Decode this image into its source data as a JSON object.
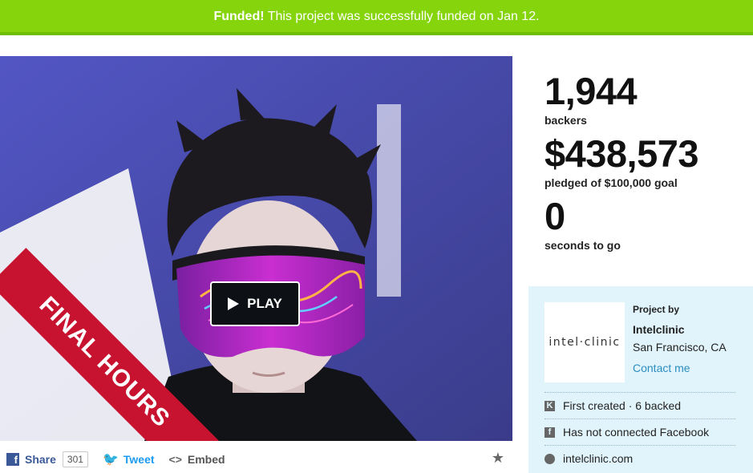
{
  "banner": {
    "funded_label": "Funded!",
    "message": "This project was successfully funded on Jan 12.",
    "color": "#86d40c"
  },
  "video": {
    "play_label": "PLAY",
    "ribbon_text": "FINAL HOURS",
    "ribbon_color": "#c7132f"
  },
  "share_bar": {
    "share_label": "Share",
    "share_count": "301",
    "tweet_label": "Tweet",
    "embed_label": "Embed",
    "embed_icon": "<>"
  },
  "stats": {
    "backers_value": "1,944",
    "backers_label": "backers",
    "pledged_value": "$438,573",
    "pledged_label": "pledged of $100,000 goal",
    "time_value": "0",
    "time_label": "seconds to go"
  },
  "creator": {
    "logo_text": "intel·clinic",
    "project_by": "Project by",
    "name": "Intelclinic",
    "location": "San Francisco, CA",
    "contact": "Contact me",
    "first_created": "First created · 6 backed",
    "facebook": "Has not connected Facebook",
    "website": "intelclinic.com"
  },
  "icons": {
    "facebook": "facebook-icon",
    "twitter": "twitter-icon",
    "embed": "embed-icon",
    "star": "star-icon",
    "kickstarter": "kickstarter-icon",
    "globe": "globe-icon"
  }
}
